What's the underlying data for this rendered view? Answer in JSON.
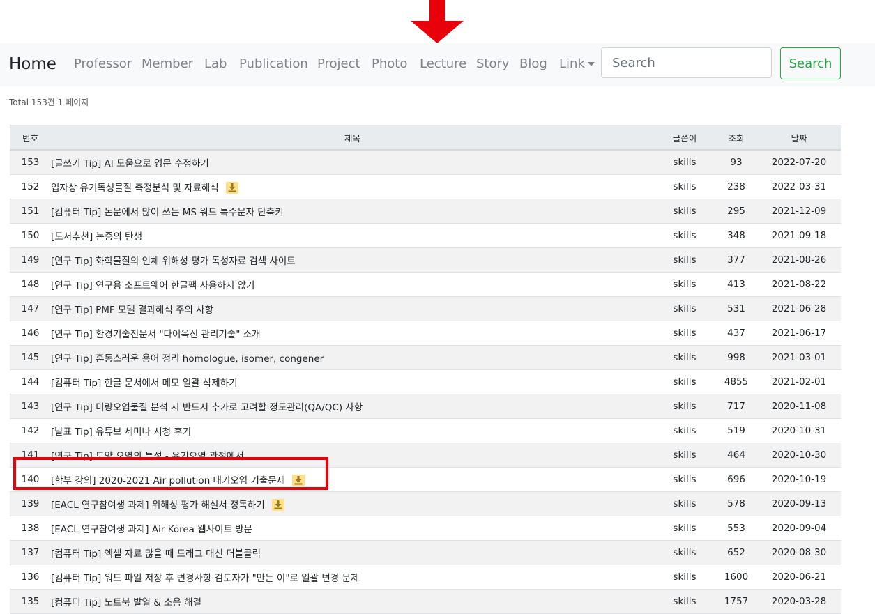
{
  "colors": {
    "arrow": "#e8000b",
    "highlight": "#e8000b",
    "search_button": "#28a745",
    "download_badge": "#ffe08a"
  },
  "navbar": {
    "brand": "Home",
    "links": [
      "Professor",
      "Member",
      "Lab",
      "Publication",
      "Project",
      "Photo",
      "Lecture",
      "Story",
      "Blog",
      "Link"
    ],
    "search_placeholder": "Search",
    "search_button": "Search"
  },
  "board": {
    "total": "Total 153건 1 페이지",
    "columns": [
      "번호",
      "제목",
      "글쓴이",
      "조회",
      "날짜"
    ],
    "rows": [
      {
        "num": "153",
        "title": "[글쓰기 Tip] AI 도움으로 영문 수정하기",
        "file": false,
        "writer": "skills",
        "views": "93",
        "date": "2022-07-20"
      },
      {
        "num": "152",
        "title": "입자상 유기독성물질 측정분석 및 자료해석",
        "file": true,
        "writer": "skills",
        "views": "238",
        "date": "2022-03-31"
      },
      {
        "num": "151",
        "title": "[컴퓨터 Tip] 논문에서 많이 쓰는 MS 워드 특수문자 단축키",
        "file": false,
        "writer": "skills",
        "views": "295",
        "date": "2021-12-09"
      },
      {
        "num": "150",
        "title": "[도서추천] 논증의 탄생",
        "file": false,
        "writer": "skills",
        "views": "348",
        "date": "2021-09-18"
      },
      {
        "num": "149",
        "title": "[연구 Tip] 화학물질의 인체 위해성 평가 독성자료 검색 사이트",
        "file": false,
        "writer": "skills",
        "views": "377",
        "date": "2021-08-26"
      },
      {
        "num": "148",
        "title": "[연구 Tip] 연구용 소프트웨어 한글팩 사용하지 않기",
        "file": false,
        "writer": "skills",
        "views": "413",
        "date": "2021-08-22"
      },
      {
        "num": "147",
        "title": "[연구 Tip] PMF 모델 결과해석 주의 사항",
        "file": false,
        "writer": "skills",
        "views": "531",
        "date": "2021-06-28"
      },
      {
        "num": "146",
        "title": "[연구 Tip] 환경기술전문서 \"다이옥신 관리기술\" 소개",
        "file": false,
        "writer": "skills",
        "views": "437",
        "date": "2021-06-17"
      },
      {
        "num": "145",
        "title": "[연구 Tip] 혼동스러운 용어 정리 homologue, isomer, congener",
        "file": false,
        "writer": "skills",
        "views": "998",
        "date": "2021-03-01"
      },
      {
        "num": "144",
        "title": "[컴퓨터 Tip] 한글 문서에서 메모 일괄 삭제하기",
        "file": false,
        "writer": "skills",
        "views": "4855",
        "date": "2021-02-01"
      },
      {
        "num": "143",
        "title": "[연구 Tip] 미량오염물질 분석 시 반드시 추가로 고려할 정도관리(QA/QC) 사항",
        "file": false,
        "writer": "skills",
        "views": "717",
        "date": "2020-11-08"
      },
      {
        "num": "142",
        "title": "[발표 Tip] 유튜브 세미나 시청 후기",
        "file": false,
        "writer": "skills",
        "views": "519",
        "date": "2020-10-31"
      },
      {
        "num": "141",
        "title": "[연구 Tip] 토양 오염의 특성 - 유기오염 관점에서",
        "file": false,
        "writer": "skills",
        "views": "464",
        "date": "2020-10-30"
      },
      {
        "num": "140",
        "title": "[학부 강의] 2020-2021 Air pollution 대기오염 기출문제",
        "file": true,
        "writer": "skills",
        "views": "696",
        "date": "2020-10-19"
      },
      {
        "num": "139",
        "title": "[EACL 연구참여생 과제] 위해성 평가 해설서 정독하기",
        "file": true,
        "writer": "skills",
        "views": "578",
        "date": "2020-09-13"
      },
      {
        "num": "138",
        "title": "[EACL 연구참여생 과제] Air Korea 웹사이트 방문",
        "file": false,
        "writer": "skills",
        "views": "553",
        "date": "2020-09-04"
      },
      {
        "num": "137",
        "title": "[컴퓨터 Tip] 엑셀 자료 많을 때 드래그 대신 더블클릭",
        "file": false,
        "writer": "skills",
        "views": "652",
        "date": "2020-08-30"
      },
      {
        "num": "136",
        "title": "[컴퓨터 Tip] 워드 파일 저장 후 변경사항 검토자가 \"만든 이\"로 일괄 변경 문제",
        "file": false,
        "writer": "skills",
        "views": "1600",
        "date": "2020-06-21"
      },
      {
        "num": "135",
        "title": "[컴퓨터 Tip] 노트북 발열 & 소음 해결",
        "file": false,
        "writer": "skills",
        "views": "1757",
        "date": "2020-03-28"
      }
    ]
  }
}
